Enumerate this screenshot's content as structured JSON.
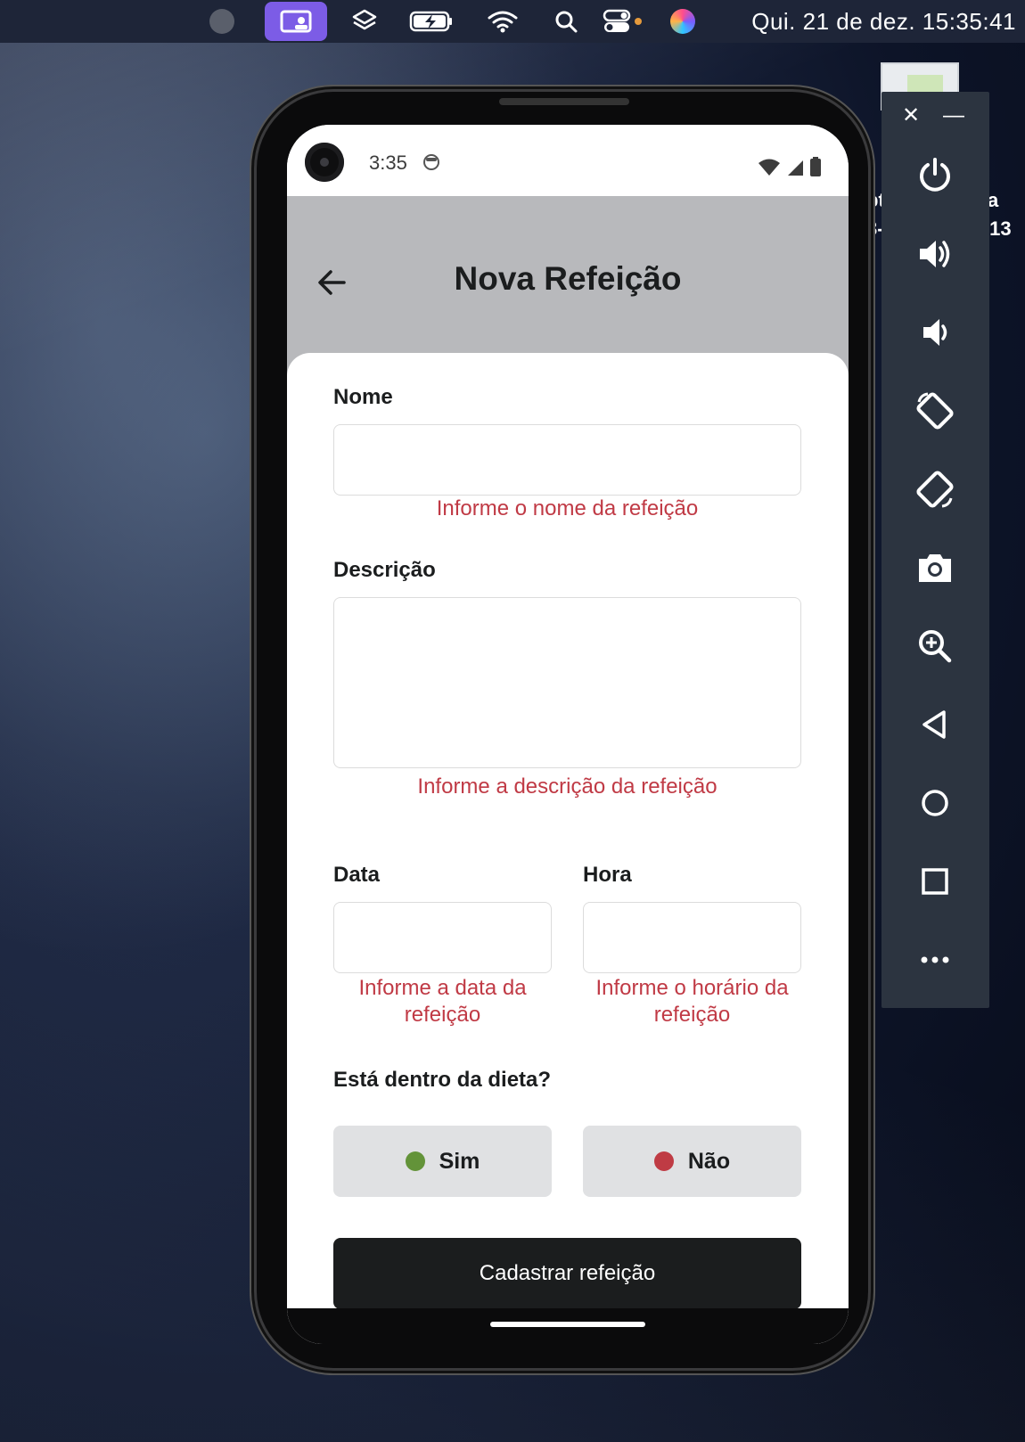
{
  "menubar": {
    "datetime": "Qui. 21 de dez.  15:35:41",
    "icons": [
      "record-dot-icon",
      "screen-share-icon",
      "layers-icon",
      "battery-charging-icon",
      "wifi-icon",
      "search-icon",
      "control-center-icon",
      "siri-icon"
    ]
  },
  "emulator": {
    "close_label": "✕",
    "minimize_label": "—",
    "buttons": [
      "power-icon",
      "volume-up-icon",
      "volume-down-icon",
      "rotate-left-icon",
      "rotate-right-icon",
      "camera-icon",
      "zoom-icon",
      "back-icon",
      "home-icon",
      "overview-icon",
      "more-icon"
    ],
    "behind_text_1": "pt",
    "behind_text_2": "a",
    "behind_text_3": "3-",
    "behind_text_4": ".13"
  },
  "phone": {
    "status_time": "3:35",
    "title": "Nova Refeição",
    "form": {
      "name_label": "Nome",
      "name_value": "",
      "name_error": "Informe o nome da refeição",
      "description_label": "Descrição",
      "description_value": "",
      "description_error": "Informe a descrição da refeição",
      "date_label": "Data",
      "date_value": "",
      "date_error": "Informe a data da refeição",
      "time_label": "Hora",
      "time_value": "",
      "time_error": "Informe o horário da refeição",
      "diet_question": "Está dentro da dieta?",
      "yes_label": "Sim",
      "no_label": "Não",
      "submit_label": "Cadastrar refeição"
    },
    "colors": {
      "yes_dot": "#639339",
      "no_dot": "#bf3b44",
      "error_text": "#c03a45",
      "header_bg": "#b8b9bc",
      "button_bg": "#1b1d1e"
    }
  }
}
